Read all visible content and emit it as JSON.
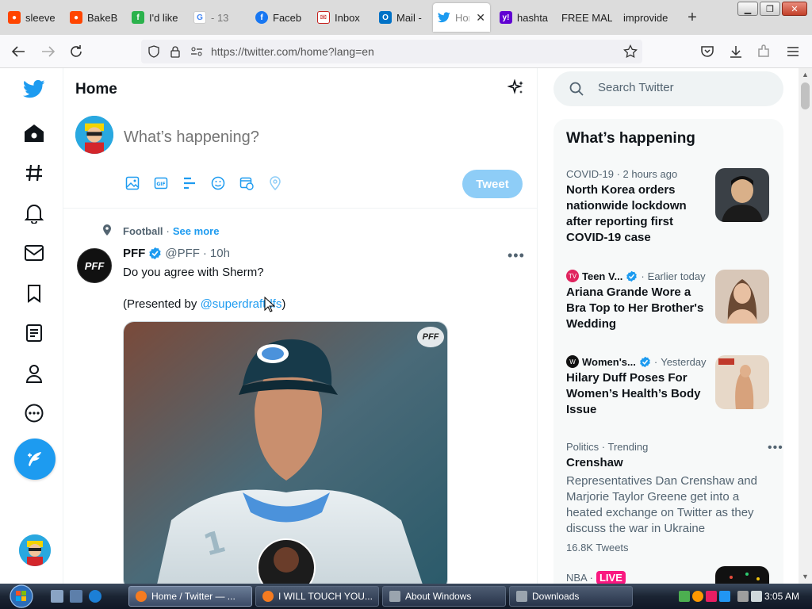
{
  "browser": {
    "tabs": [
      {
        "label": "sleeve",
        "icon": "reddit-icon",
        "color": "#ff4500"
      },
      {
        "label": "BakeB",
        "icon": "reddit-icon",
        "color": "#ff4500"
      },
      {
        "label": "I'd like",
        "icon": "feedly-icon",
        "color": "#2bb24c"
      },
      {
        "label": "- 13",
        "icon": "google-icon",
        "color": "#4285f4"
      },
      {
        "label": "Faceb",
        "icon": "facebook-icon",
        "color": "#1877f2"
      },
      {
        "label": "Inbox",
        "icon": "mail-icon",
        "color": "#c5221f"
      },
      {
        "label": "Mail -",
        "icon": "outlook-icon",
        "color": "#0072c6"
      },
      {
        "label": "Hor",
        "icon": "twitter-icon",
        "color": "#1d9bf0",
        "active": true
      },
      {
        "label": "hashta",
        "icon": "yahoo-icon",
        "color": "#6001d2"
      },
      {
        "label": "FREE MAL",
        "icon": "",
        "color": ""
      },
      {
        "label": "improvide",
        "icon": "",
        "color": ""
      }
    ],
    "new_tab": "+",
    "url": "https://twitter.com/home?lang=en",
    "tab_close": "✕"
  },
  "twitter": {
    "brand_color": "#1d9bf0",
    "home_title": "Home",
    "composer": {
      "placeholder": "What’s happening?",
      "tweet_button": "Tweet"
    },
    "tweet": {
      "topic": "Football",
      "see_more": "See more",
      "author_name": "PFF",
      "avatar_text": "PFF",
      "handle": "@PFF",
      "time": "10h",
      "text_line1": "Do you agree with Sherm?",
      "text_line2_prefix": "(Presented by ",
      "mention": "@superdraftdfs",
      "text_line2_suffix": ")",
      "media_badge": "PFF"
    },
    "search": {
      "placeholder": "Search Twitter"
    },
    "trends": {
      "title": "What’s happening",
      "items": [
        {
          "context": "COVID-19 · 2 hours ago",
          "headline": "North Korea orders nationwide lockdown after reporting first COVID-19 case"
        },
        {
          "source": "Teen V...",
          "time": "Earlier today",
          "headline": "Ariana Grande Wore a Bra Top to Her Brother's Wedding"
        },
        {
          "source": "Women's...",
          "time": "Yesterday",
          "headline": "Hilary Duff Poses For Women’s Health’s Body Issue"
        },
        {
          "context": "Politics · Trending",
          "headline": "Crenshaw",
          "description": "Representatives Dan Crenshaw and Marjorie Taylor Greene get into a heated exchange on Twitter as they discuss the war in Ukraine",
          "count": "16.8K Tweets"
        },
        {
          "context": "NBA · ",
          "live": "LIVE"
        }
      ]
    }
  },
  "taskbar": {
    "items": [
      {
        "label": "Home / Twitter — ...",
        "active": true
      },
      {
        "label": "I WILL TOUCH YOU..."
      },
      {
        "label": "About Windows"
      },
      {
        "label": "Downloads"
      }
    ],
    "clock": "3:05 AM"
  }
}
